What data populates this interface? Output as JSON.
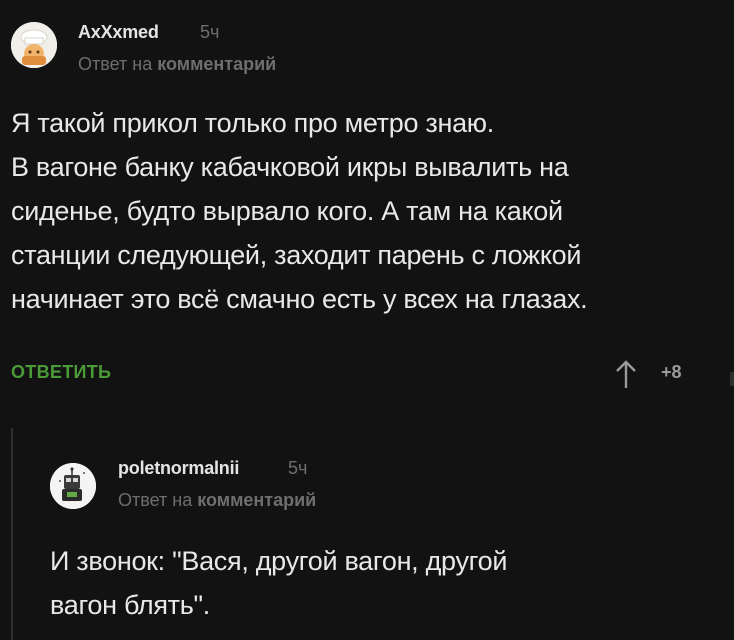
{
  "comment1": {
    "username": "AxXxmed",
    "time": "5ч",
    "reply_prefix": "Ответ на",
    "reply_target": "комментарий",
    "text_lines": [
      "Я такой прикол только про метро знаю.",
      "В вагоне банку кабачковой икры вывалить на",
      "сиденье, будто вырвало кого. А там на какой",
      "станции следующей, заходит парень с ложкой",
      "начинает это всё смачно есть у всех на глазах."
    ],
    "reply_button": "ОТВЕТИТЬ",
    "rating": "+8"
  },
  "comment2": {
    "username": "poletnormalnii",
    "time": "5ч",
    "reply_prefix": "Ответ на",
    "reply_target": "комментарий",
    "text_lines": [
      "И звонок: \"Вася, другой вагон, другой",
      "вагон блять\"."
    ]
  },
  "colors": {
    "background": "#121212",
    "accent_green": "#4a9a37",
    "muted": "#6e6e6e"
  },
  "icons": {
    "upvote": "arrow-up-icon",
    "avatar1": "chef-avatar",
    "avatar2": "robot-avatar"
  }
}
